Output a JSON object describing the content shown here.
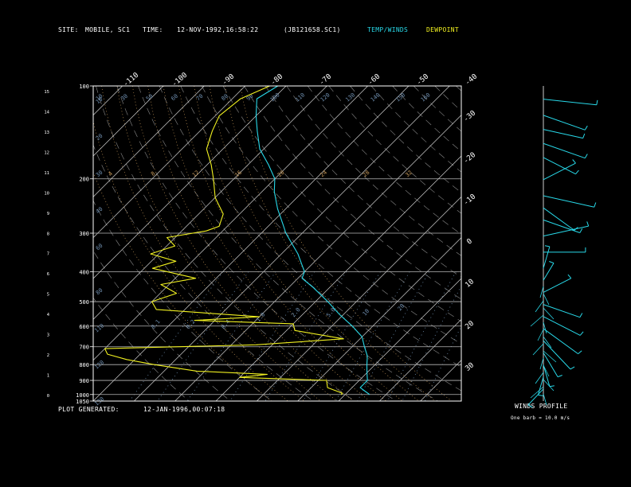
{
  "header": {
    "site_label": "SITE:",
    "site_value": "MOBILE, SC1",
    "time_label": "TIME:",
    "time_value": "12-NOV-1992,16:58:22",
    "file_id": "(JB121658.SC1)",
    "temp_winds_legend": "TEMP/WINDS",
    "dewpoint_legend": "DEWPOINT"
  },
  "footer": {
    "generated_label": "PLOT GENERATED:",
    "generated_value": "12-JAN-1996,00:07:18"
  },
  "winds_panel": {
    "title": "WINDS PROFILE",
    "note": "One barb = 10.0 m/s"
  },
  "colors": {
    "background": "#000000",
    "frame": "#ffffff",
    "isobar": "#b8b8b8",
    "isotherm": "#cfcfcf",
    "dry_adiabat": "#8a8a8a",
    "moist_adiabat": "#c89a5a",
    "mixing_ratio": "#6f8fb0",
    "temperature": "#28d8e8",
    "dewpoint": "#f0f020",
    "wind": "#28d8e8"
  },
  "chart_data": {
    "type": "line",
    "title": "",
    "pressure_labels": [
      "100",
      "200",
      "300",
      "400",
      "500",
      "600",
      "700",
      "800",
      "900",
      "1000",
      "1050"
    ],
    "pressure_values": [
      100,
      200,
      300,
      400,
      500,
      600,
      700,
      800,
      900,
      1000,
      1050
    ],
    "height_km_labels": [
      "0",
      "1",
      "2",
      "3",
      "4",
      "5",
      "6",
      "7",
      "8",
      "9",
      "10",
      "11",
      "12",
      "13",
      "14",
      "15"
    ],
    "isotherm_top_labels": [
      "-110",
      "-100",
      "-90",
      "-80",
      "-70",
      "-60",
      "-50",
      "-40"
    ],
    "isotherm_right_labels": [
      "-30",
      "-20",
      "-10",
      "0",
      "10",
      "20",
      "30"
    ],
    "mixing_ratio_labels": [
      {
        "text": "0.1",
        "p": 590
      },
      {
        "text": "0.2",
        "p": 590
      },
      {
        "text": "0.4",
        "p": 590
      },
      {
        "text": "1.0",
        "p": 560
      },
      {
        "text": "2.0",
        "p": 540
      },
      {
        "text": "5.0",
        "p": 540
      },
      {
        "text": "10",
        "p": 540
      },
      {
        "text": "20",
        "p": 520
      }
    ],
    "adiabat_labels_top": [
      "10",
      "30",
      "50",
      "60",
      "70",
      "80",
      "90",
      "100",
      "110",
      "120",
      "130",
      "140",
      "150",
      "160"
    ],
    "adiabat_labels_left": [
      "10",
      "20",
      "30",
      "40",
      "60",
      "80",
      "110",
      "120",
      "130"
    ],
    "moist_labels": [
      "4",
      "8",
      "12",
      "16",
      "20",
      "24",
      "28",
      "32"
    ],
    "series": [
      {
        "name": "TEMP/WINDS",
        "points": [
          {
            "p": 100,
            "t": -82
          },
          {
            "p": 110,
            "t": -84
          },
          {
            "p": 125,
            "t": -80
          },
          {
            "p": 140,
            "t": -76
          },
          {
            "p": 160,
            "t": -71
          },
          {
            "p": 180,
            "t": -65
          },
          {
            "p": 200,
            "t": -60
          },
          {
            "p": 220,
            "t": -57
          },
          {
            "p": 250,
            "t": -52
          },
          {
            "p": 280,
            "t": -47
          },
          {
            "p": 300,
            "t": -44
          },
          {
            "p": 350,
            "t": -36
          },
          {
            "p": 400,
            "t": -30
          },
          {
            "p": 420,
            "t": -29
          },
          {
            "p": 450,
            "t": -24
          },
          {
            "p": 500,
            "t": -17
          },
          {
            "p": 550,
            "t": -11
          },
          {
            "p": 600,
            "t": -5
          },
          {
            "p": 650,
            "t": 0
          },
          {
            "p": 700,
            "t": 3
          },
          {
            "p": 750,
            "t": 6
          },
          {
            "p": 800,
            "t": 8
          },
          {
            "p": 850,
            "t": 10
          },
          {
            "p": 900,
            "t": 12
          },
          {
            "p": 950,
            "t": 12
          },
          {
            "p": 975,
            "t": 14
          },
          {
            "p": 1000,
            "t": 16
          }
        ]
      },
      {
        "name": "DEWPOINT",
        "points": [
          {
            "p": 100,
            "t": -84
          },
          {
            "p": 110,
            "t": -88
          },
          {
            "p": 125,
            "t": -89
          },
          {
            "p": 140,
            "t": -87
          },
          {
            "p": 160,
            "t": -84
          },
          {
            "p": 180,
            "t": -79
          },
          {
            "p": 200,
            "t": -75
          },
          {
            "p": 230,
            "t": -70
          },
          {
            "p": 260,
            "t": -64
          },
          {
            "p": 285,
            "t": -62
          },
          {
            "p": 295,
            "t": -64
          },
          {
            "p": 310,
            "t": -72
          },
          {
            "p": 330,
            "t": -68
          },
          {
            "p": 350,
            "t": -72
          },
          {
            "p": 370,
            "t": -64
          },
          {
            "p": 390,
            "t": -68
          },
          {
            "p": 420,
            "t": -55
          },
          {
            "p": 440,
            "t": -62
          },
          {
            "p": 470,
            "t": -56
          },
          {
            "p": 500,
            "t": -60
          },
          {
            "p": 530,
            "t": -57
          },
          {
            "p": 560,
            "t": -30
          },
          {
            "p": 575,
            "t": -45
          },
          {
            "p": 590,
            "t": -20
          },
          {
            "p": 620,
            "t": -18
          },
          {
            "p": 660,
            "t": -4
          },
          {
            "p": 690,
            "t": -24
          },
          {
            "p": 710,
            "t": -60
          },
          {
            "p": 740,
            "t": -58
          },
          {
            "p": 770,
            "t": -52
          },
          {
            "p": 800,
            "t": -44
          },
          {
            "p": 840,
            "t": -32
          },
          {
            "p": 860,
            "t": -14
          },
          {
            "p": 880,
            "t": -20
          },
          {
            "p": 900,
            "t": 2
          },
          {
            "p": 950,
            "t": 4
          },
          {
            "p": 990,
            "t": 9
          },
          {
            "p": 1000,
            "t": 9
          }
        ]
      }
    ],
    "winds": [
      {
        "z": 15.0,
        "spd": 30,
        "dir": 280
      },
      {
        "z": 14.2,
        "spd": 25,
        "dir": 300
      },
      {
        "z": 13.5,
        "spd": 20,
        "dir": 290
      },
      {
        "z": 12.8,
        "spd": 25,
        "dir": 300
      },
      {
        "z": 12.1,
        "spd": 20,
        "dir": 310
      },
      {
        "z": 11.0,
        "spd": 20,
        "dir": 230
      },
      {
        "z": 10.2,
        "spd": 30,
        "dir": 290
      },
      {
        "z": 9.6,
        "spd": 25,
        "dir": 320
      },
      {
        "z": 9.0,
        "spd": 20,
        "dir": 300
      },
      {
        "z": 8.2,
        "spd": 25,
        "dir": 250
      },
      {
        "z": 7.4,
        "spd": 20,
        "dir": 270
      },
      {
        "z": 6.6,
        "spd": 15,
        "dir": 190
      },
      {
        "z": 6.0,
        "spd": 10,
        "dir": 200
      },
      {
        "z": 5.4,
        "spd": 15,
        "dir": 230
      },
      {
        "z": 4.8,
        "spd": 20,
        "dir": 300
      },
      {
        "z": 4.2,
        "spd": 25,
        "dir": 310
      },
      {
        "z": 3.6,
        "spd": 30,
        "dir": 320
      },
      {
        "z": 3.0,
        "spd": 30,
        "dir": 330
      },
      {
        "z": 2.4,
        "spd": 20,
        "dir": 340
      },
      {
        "z": 1.8,
        "spd": 15,
        "dir": 350
      },
      {
        "z": 1.2,
        "spd": 10,
        "dir": 10
      },
      {
        "z": 0.6,
        "spd": 10,
        "dir": 30
      }
    ]
  }
}
